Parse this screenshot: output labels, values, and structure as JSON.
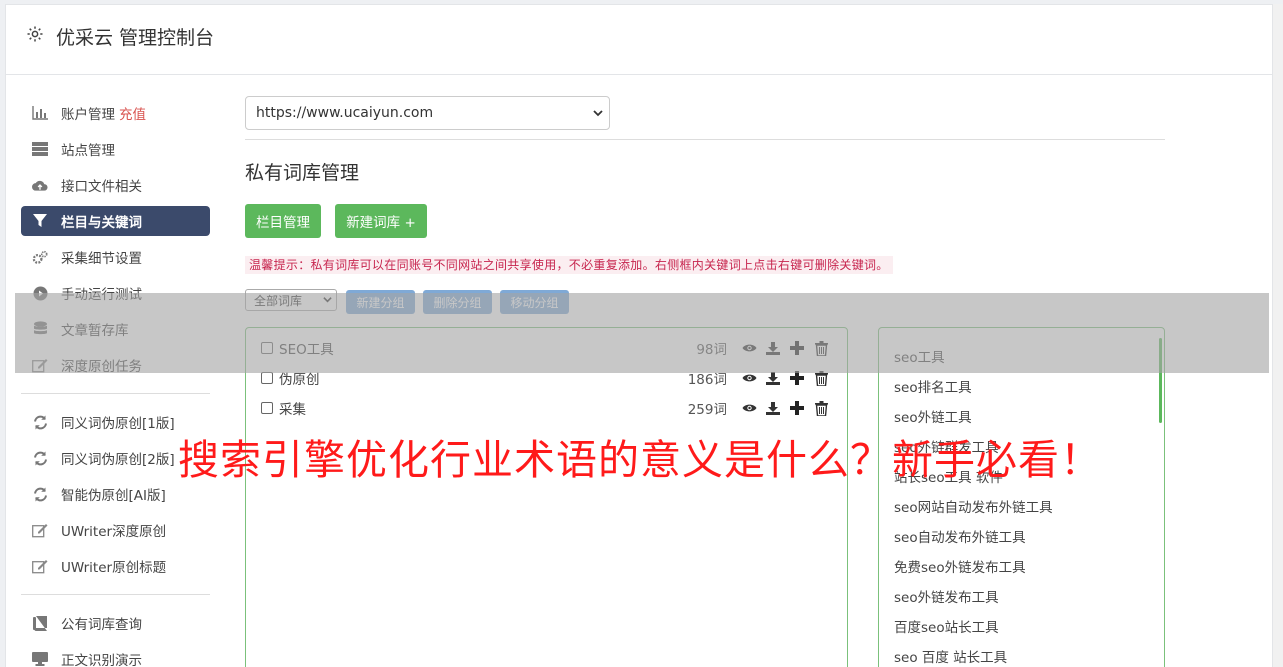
{
  "header": {
    "title": "优采云 管理控制台"
  },
  "sidebar": {
    "items": [
      {
        "label": "账户管理",
        "badge": "充值",
        "icon": "bar-chart-icon"
      },
      {
        "label": "站点管理",
        "icon": "server-icon"
      },
      {
        "label": "接口文件相关",
        "icon": "cloud-upload-icon"
      },
      {
        "label": "栏目与关键词",
        "icon": "filter-icon"
      },
      {
        "label": "采集细节设置",
        "icon": "cogs-icon"
      },
      {
        "label": "手动运行测试",
        "icon": "play-circle-icon"
      },
      {
        "label": "文章暂存库",
        "icon": "database-icon"
      },
      {
        "label": "深度原创任务",
        "icon": "edit-icon"
      },
      {
        "label": "同义词伪原创[1版]",
        "icon": "refresh-icon"
      },
      {
        "label": "同义词伪原创[2版]",
        "icon": "refresh-icon"
      },
      {
        "label": "智能伪原创[AI版]",
        "icon": "refresh-icon"
      },
      {
        "label": "UWriter深度原创",
        "icon": "edit-icon"
      },
      {
        "label": "UWriter原创标题",
        "icon": "edit-icon"
      },
      {
        "label": "公有词库查询",
        "icon": "book-icon"
      },
      {
        "label": "正文识别演示",
        "icon": "desktop-icon"
      }
    ]
  },
  "main": {
    "site_select": "https://www.ucaiyun.com",
    "section_title": "私有词库管理",
    "btn_column": "栏目管理",
    "btn_new_lib": "新建词库 +",
    "tip": "温馨提示：私有词库可以在同账号不同网站之间共享使用，不必重复添加。右侧框内关键词上点击右键可删除关键词。",
    "group_select": "全部词库",
    "btn_new_group": "新建分组",
    "btn_delete_group": "删除分组",
    "btn_move_group": "移动分组",
    "libraries": [
      {
        "name": "SEO工具",
        "count": "98词"
      },
      {
        "name": "伪原创",
        "count": "186词"
      },
      {
        "name": "采集",
        "count": "259词"
      }
    ],
    "keywords": [
      "seo工具",
      "seo排名工具",
      "seo外链工具",
      "seo外链群发工具",
      "站长seo工具 软件",
      "seo网站自动发布外链工具",
      "seo自动发布外链工具",
      "免费seo外链发布工具",
      "seo外链发布工具",
      "百度seo站长工具",
      "seo 百度 站长工具"
    ]
  },
  "overlay": {
    "headline": "搜索引擎优化行业术语的意义是什么？新手必看！"
  },
  "colors": {
    "active_nav": "#3b4a6b",
    "green": "#5cb85c",
    "blue_btn": "#7fa9d6",
    "headline_red": "#ff1a1a",
    "charge_red": "#d9534f"
  }
}
